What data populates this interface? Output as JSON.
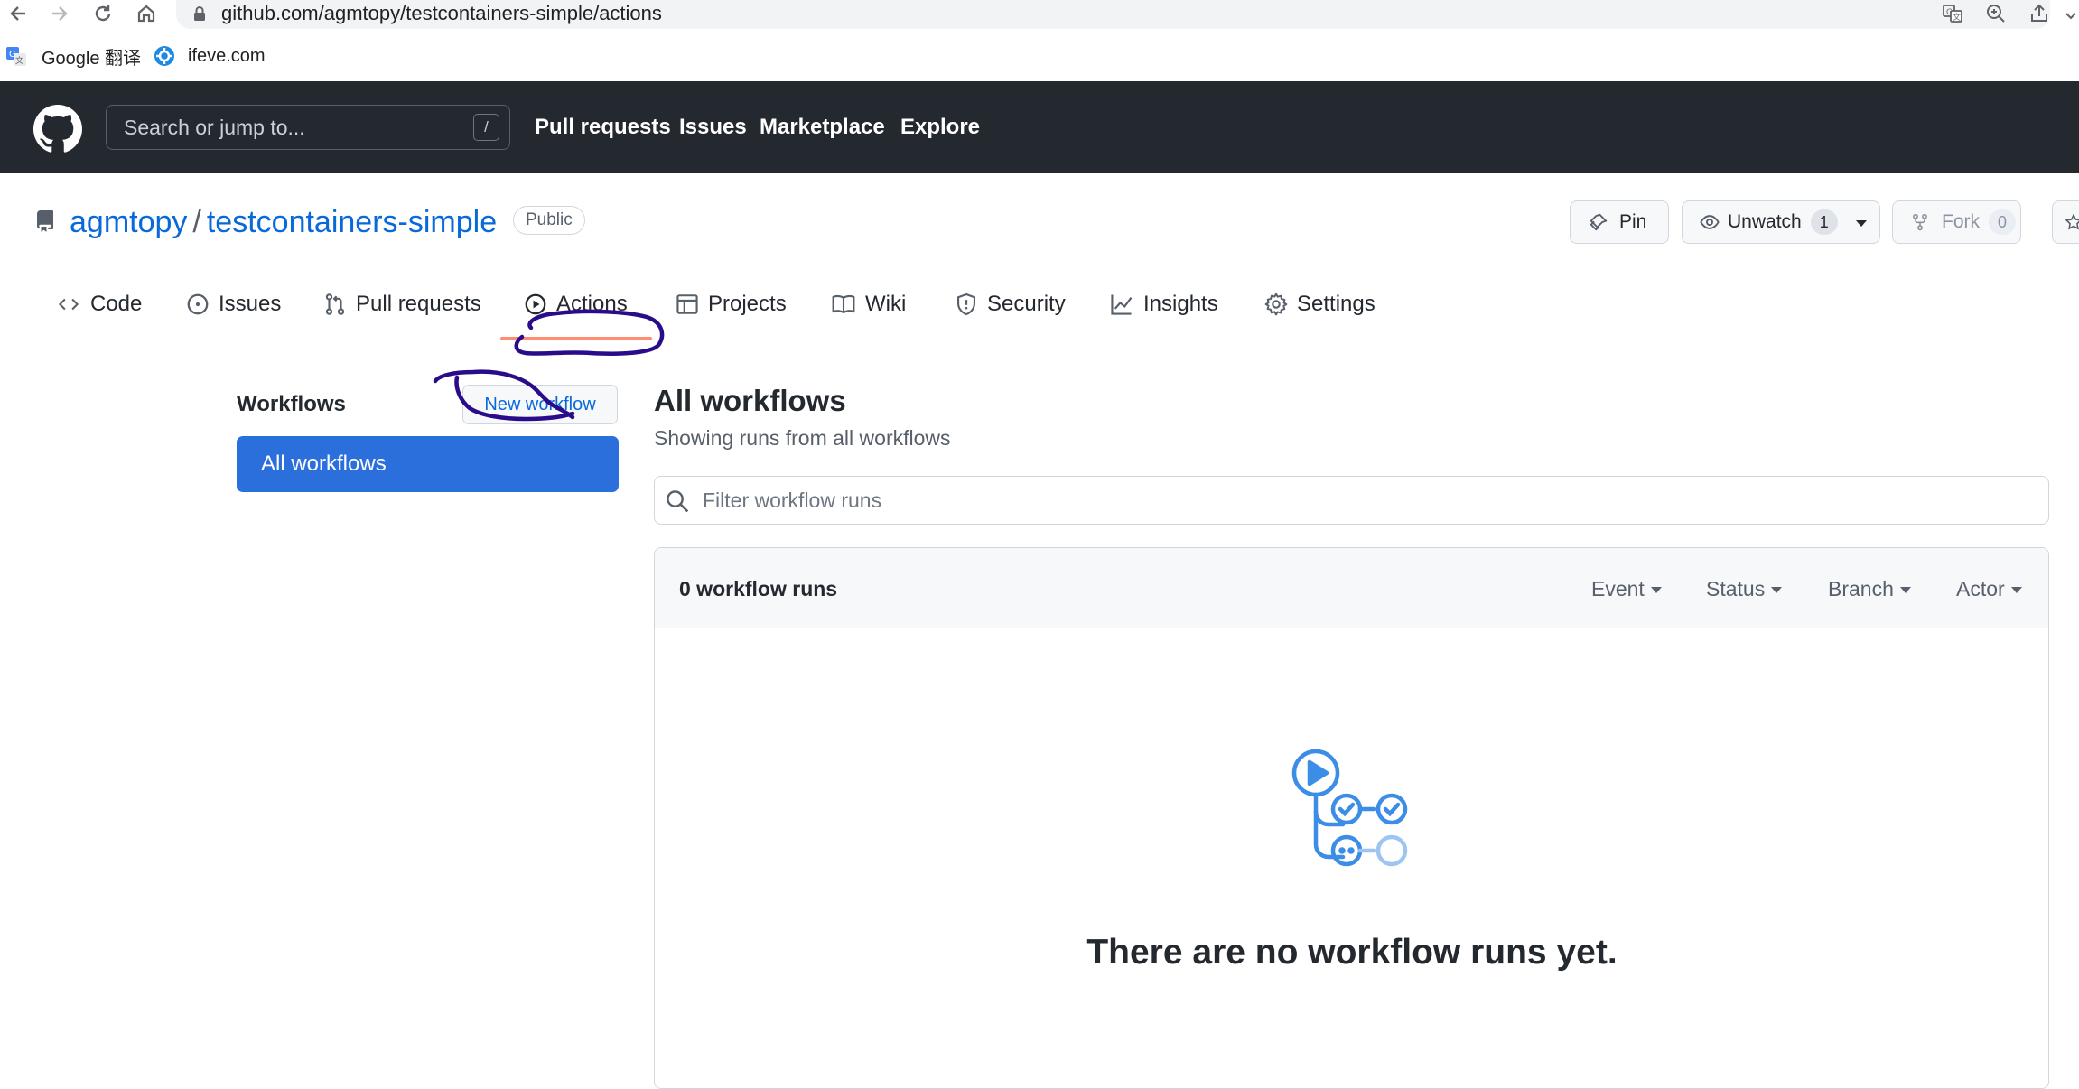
{
  "browser": {
    "url": "github.com/agmtopy/testcontainers-simple/actions",
    "bookmarks": [
      "Google 翻译",
      "ifeve.com"
    ]
  },
  "header": {
    "search_placeholder": "Search or jump to...",
    "slash_key": "/",
    "nav": [
      "Pull requests",
      "Issues",
      "Marketplace",
      "Explore"
    ]
  },
  "repo": {
    "owner": "agmtopy",
    "separator": "/",
    "name": "testcontainers-simple",
    "visibility": "Public",
    "pin_label": "Pin",
    "unwatch_label": "Unwatch",
    "watch_count": "1",
    "fork_label": "Fork",
    "fork_count": "0"
  },
  "tabs": [
    "Code",
    "Issues",
    "Pull requests",
    "Actions",
    "Projects",
    "Wiki",
    "Security",
    "Insights",
    "Settings"
  ],
  "active_tab": "Actions",
  "sidebar": {
    "title": "Workflows",
    "new_workflow": "New workflow",
    "items": [
      "All workflows"
    ]
  },
  "main": {
    "title": "All workflows",
    "subtitle": "Showing runs from all workflows",
    "filter_placeholder": "Filter workflow runs",
    "runs_count": "0 workflow runs",
    "filters": [
      "Event",
      "Status",
      "Branch",
      "Actor"
    ],
    "empty_message": "There are no workflow runs yet."
  },
  "colors": {
    "header_bg": "#24292f",
    "link": "#0969da",
    "selected_item": "#2b6fdc",
    "active_tab_underline": "#fd8c73",
    "annotation_ink": "#2a0c8a",
    "illustration": "#3b8de6"
  }
}
